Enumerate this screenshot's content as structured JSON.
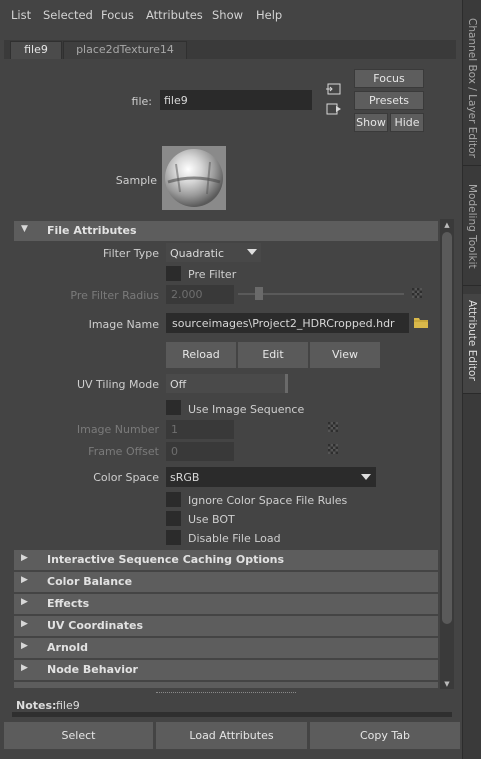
{
  "menu": [
    "List",
    "Selected",
    "Focus",
    "Attributes",
    "Show",
    "Help"
  ],
  "side_tabs": [
    "Channel Box / Layer Editor",
    "Modeling Toolkit",
    "Attribute Editor"
  ],
  "node_tabs": [
    "file9",
    "place2dTexture14"
  ],
  "header": {
    "file_label": "file:",
    "file_value": "file9",
    "focus": "Focus",
    "presets": "Presets",
    "show": "Show",
    "hide": "Hide",
    "sample_label": "Sample"
  },
  "file_attributes": {
    "title": "File Attributes",
    "filter_type_label": "Filter Type",
    "filter_type_value": "Quadratic",
    "pre_filter_label": "Pre Filter",
    "pre_filter_radius_label": "Pre Filter Radius",
    "pre_filter_radius_value": "2.000",
    "image_name_label": "Image Name",
    "image_name_value": "sourceimages\\Project2_HDRCropped.hdr",
    "reload": "Reload",
    "edit": "Edit",
    "view": "View",
    "uv_tiling_label": "UV Tiling Mode",
    "uv_tiling_value": "Off",
    "use_image_sequence": "Use Image Sequence",
    "image_number_label": "Image Number",
    "image_number_value": "1",
    "frame_offset_label": "Frame Offset",
    "frame_offset_value": "0",
    "color_space_label": "Color Space",
    "color_space_value": "sRGB",
    "ignore_cs_rules": "Ignore Color Space File Rules",
    "use_bot": "Use BOT",
    "disable_file_load": "Disable File Load"
  },
  "sections": [
    "Interactive Sequence Caching Options",
    "Color Balance",
    "Effects",
    "UV Coordinates",
    "Arnold",
    "Node Behavior"
  ],
  "notes": {
    "label": "Notes:",
    "value": "file9"
  },
  "bottom_buttons": {
    "select": "Select",
    "load_attributes": "Load Attributes",
    "copy_tab": "Copy Tab"
  }
}
